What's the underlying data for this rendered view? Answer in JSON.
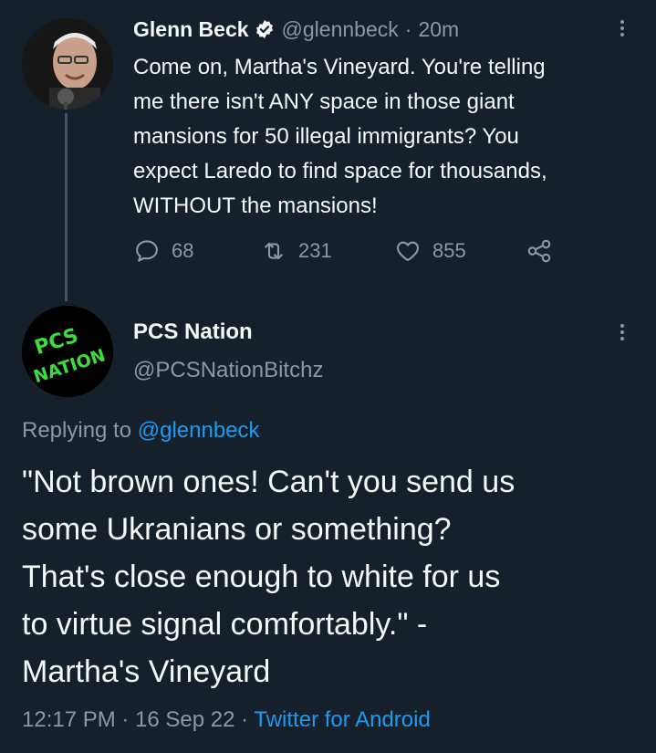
{
  "tweet1": {
    "name": "Glenn Beck",
    "handle": "@glennbeck",
    "separator": "·",
    "time": "20m",
    "lines": [
      "Come on, Martha's Vineyard. You're telling",
      "me there isn't ANY space in those giant",
      "mansions for 50 illegal immigrants? You",
      "expect Laredo to find space for thousands,",
      "WITHOUT the mansions!"
    ],
    "replies": "68",
    "retweets": "231",
    "likes": "855"
  },
  "tweet2": {
    "name": "PCS Nation",
    "handle": "@PCSNationBitchz",
    "avatar_text_1": "PCS",
    "avatar_text_2": "NATION",
    "replying_label": "Replying to",
    "replying_handle": "@glennbeck",
    "lines": [
      "\"Not brown ones! Can't you send us",
      "some Ukranians or something?",
      "That's close enough to white for us",
      "to virtue signal comfortably.\" -",
      "Martha's Vineyard"
    ],
    "timestamp": "12:17 PM · 16 Sep 22 ·",
    "client": "Twitter for Android"
  },
  "colors": {
    "background": "#15202b",
    "text": "#f7f9f9",
    "muted": "#8b98a5",
    "link": "#1d9bf0",
    "avatar_green": "#3ddc3d"
  }
}
